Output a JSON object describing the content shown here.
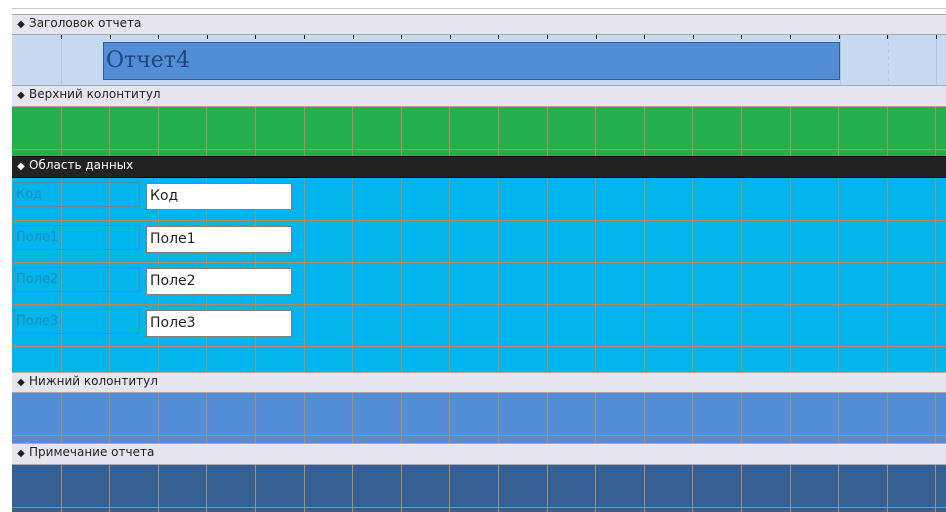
{
  "sections": {
    "report_header": {
      "label": "Заголовок отчета",
      "title_text": "Отчет4"
    },
    "page_header": {
      "label": "Верхний колонтитул"
    },
    "detail": {
      "label": "Область данных",
      "fields": [
        {
          "label": "Код",
          "control": "Код"
        },
        {
          "label": "Поле1",
          "control": "Поле1"
        },
        {
          "label": "Поле2",
          "control": "Поле2"
        },
        {
          "label": "Поле3",
          "control": "Поле3"
        }
      ]
    },
    "page_footer": {
      "label": "Нижний колонтитул"
    },
    "report_footer": {
      "label": "Примечание отчета"
    }
  },
  "colors": {
    "report_header_bg": "#c5d9f1",
    "page_header_bg": "#24b04b",
    "detail_bg": "#00b4ec",
    "page_footer_bg": "#538dd5",
    "report_footer_bg": "#356093",
    "title_box_bg": "#538dd5",
    "grid_line": "#b78a5a"
  },
  "icons": {
    "section_toggle": "section-collapse-icon"
  }
}
